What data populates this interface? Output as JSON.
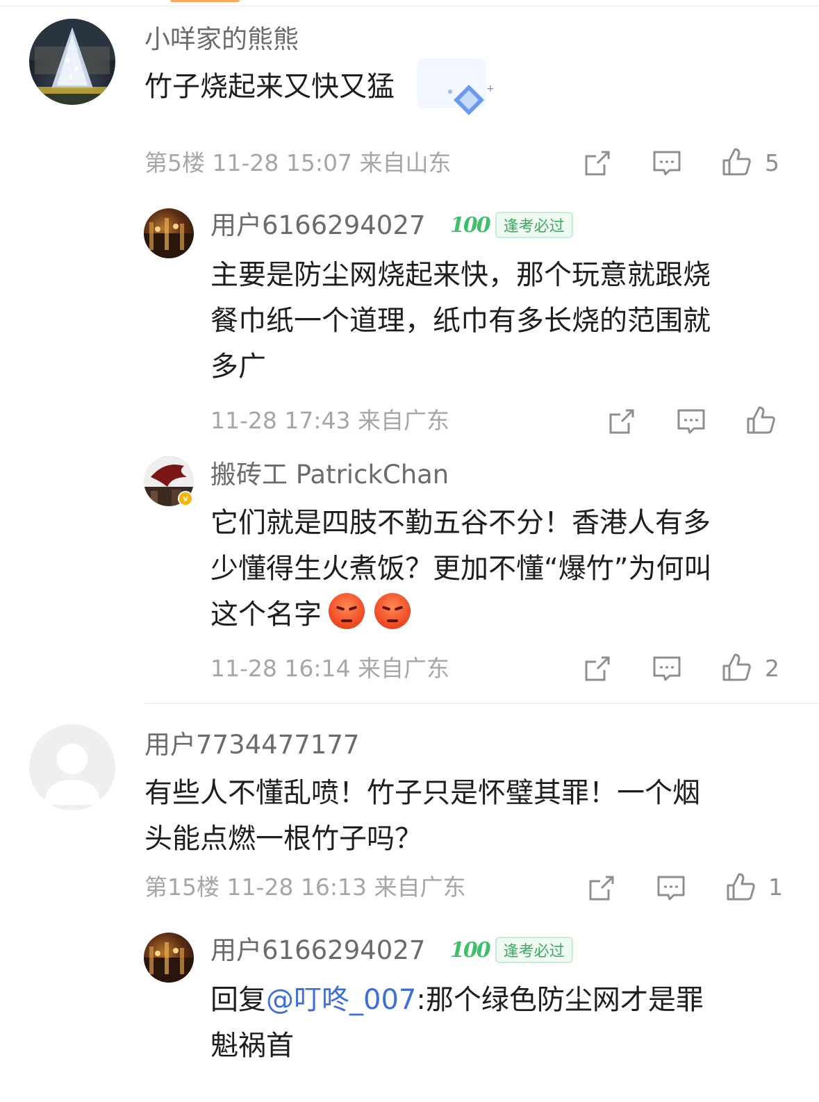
{
  "comments": [
    {
      "username": "小咩家的熊熊",
      "text_lines": [
        "竹子烧起来又快又猛"
      ],
      "meta": "第5楼 11-28 15:07 来自山东",
      "like_count": "5"
    },
    {
      "username": "用户6166294027",
      "badge_mark": "100",
      "badge_label": "逢考必过",
      "text_lines": [
        "主要是防尘网烧起来快，那个玩意就跟烧",
        "餐巾纸一个道理，纸巾有多长烧的范围就",
        "多广"
      ],
      "meta": "11-28 17:43 来自广东",
      "like_count": ""
    },
    {
      "username": "搬砖工 PatrickChan",
      "text_lines": [
        "它们就是四肢不勤五谷不分！香港人有多",
        "少懂得生火煮饭？更加不懂“爆竹”为何叫",
        "这个名字"
      ],
      "emojis": [
        "angry-emoji",
        "angry-emoji"
      ],
      "verified_mark": "v",
      "meta": "11-28 16:14 来自广东",
      "like_count": "2"
    },
    {
      "username": "用户7734477177",
      "text_lines": [
        "有些人不懂乱喷！竹子只是怀璧其罪！一个烟",
        "头能点燃一根竹子吗？"
      ],
      "meta": "第15楼 11-28 16:13 来自广东",
      "like_count": "1"
    },
    {
      "username": "用户6166294027",
      "badge_mark": "100",
      "badge_label": "逢考必过",
      "reply_prefix": "回复",
      "mention": "@叮咚_007",
      "text_lines": [
        ":那个绿色防尘网才是罪",
        "魁祸首"
      ]
    }
  ],
  "icons": {
    "share": "share-icon",
    "comment": "comment-icon",
    "like": "like-icon"
  },
  "colors": {
    "mention": "#3f6fd6",
    "badge_green": "#3fbf6a",
    "meta_gray": "#a6a6a6"
  }
}
